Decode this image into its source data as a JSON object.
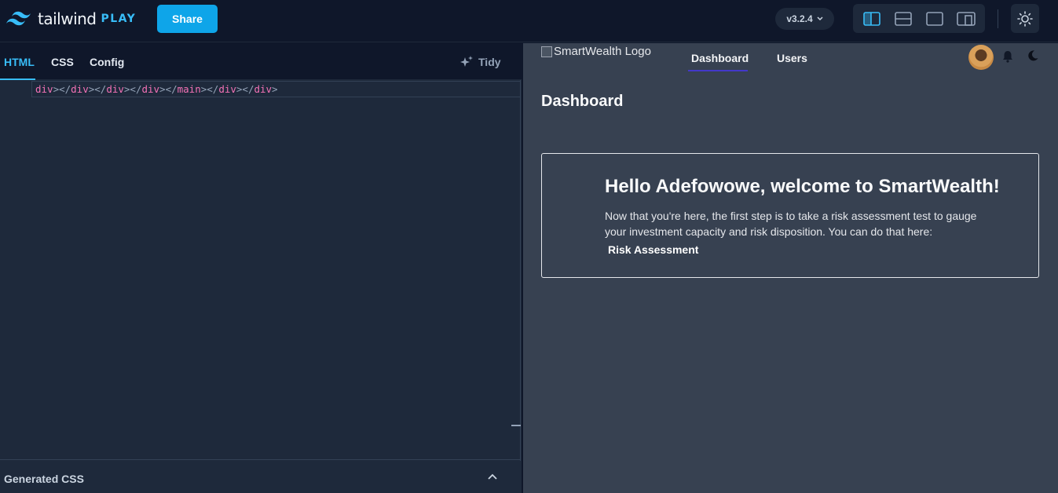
{
  "app": {
    "logo_text": "tailwind",
    "logo_suffix": "PLAY",
    "share_label": "Share",
    "version_label": "v3.2.4",
    "accent_color": "#38bdf8"
  },
  "editor": {
    "tabs": [
      {
        "label": "HTML",
        "active": true
      },
      {
        "label": "CSS",
        "active": false
      },
      {
        "label": "Config",
        "active": false
      }
    ],
    "tidy_label": "Tidy",
    "code_tokens": [
      "div",
      "></",
      "div",
      "></",
      "div",
      "></",
      "div",
      "></",
      "main",
      "></",
      "div",
      "></",
      "div",
      ">"
    ],
    "generated_css_label": "Generated CSS"
  },
  "preview": {
    "logo_alt": "SmartWealth Logo",
    "nav": [
      {
        "label": "Dashboard",
        "active": true
      },
      {
        "label": "Users",
        "active": false
      }
    ],
    "page_title": "Dashboard",
    "card": {
      "title": "Hello Adefowowe, welcome to SmartWealth!",
      "body": "Now that you're here, the first step is to take a risk assessment test to gauge your investment capacity and risk disposition. You can do that here:",
      "link_label": "Risk Assessment"
    }
  }
}
